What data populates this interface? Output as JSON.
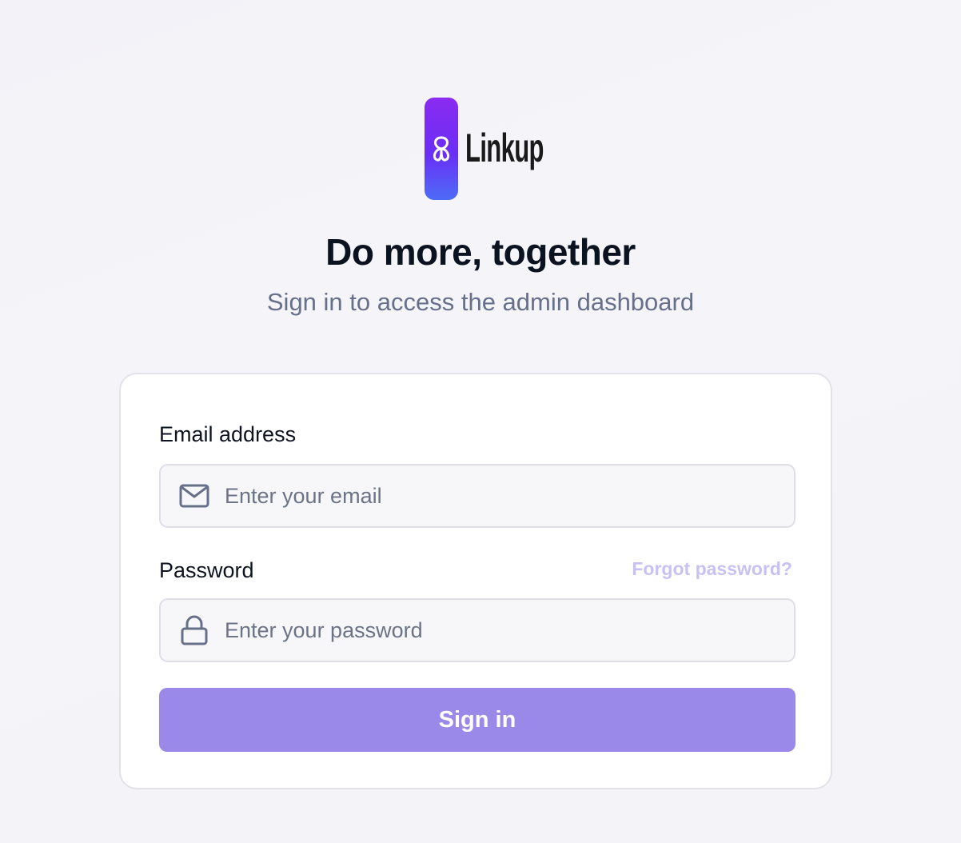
{
  "brand": {
    "name": "Linkup",
    "accent": "#9b89ea",
    "logo_gradient": [
      "#8a2bf0",
      "#4c6cf7"
    ]
  },
  "header": {
    "title": "Do more, together",
    "subtitle": "Sign in to access the admin dashboard"
  },
  "form": {
    "email": {
      "label": "Email address",
      "placeholder": "Enter your email",
      "icon": "mail-icon"
    },
    "password": {
      "label": "Password",
      "placeholder": "Enter your password",
      "icon": "lock-icon",
      "forgot_label": "Forgot password?"
    },
    "submit_label": "Sign in"
  }
}
